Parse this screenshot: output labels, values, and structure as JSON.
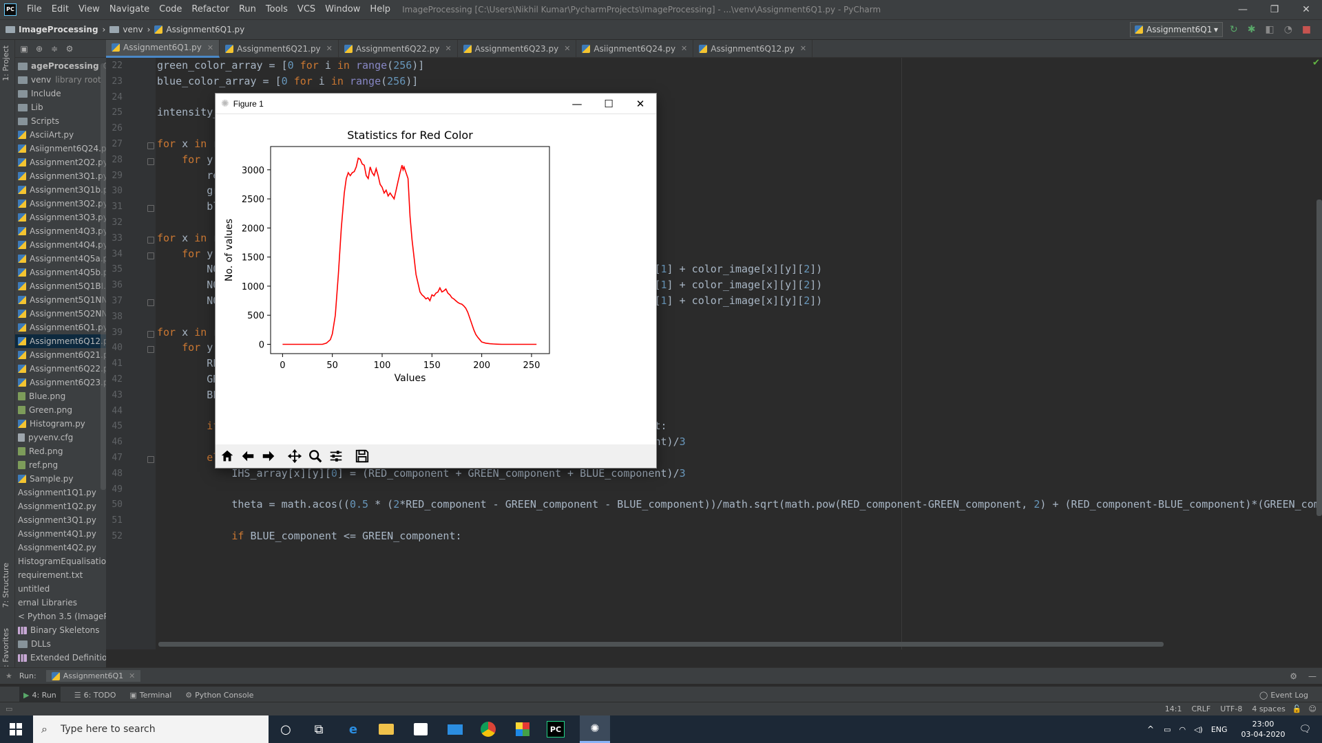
{
  "titlebar": {
    "menu": [
      "File",
      "Edit",
      "View",
      "Navigate",
      "Code",
      "Refactor",
      "Run",
      "Tools",
      "VCS",
      "Window",
      "Help"
    ],
    "window_title": "ImageProcessing [C:\\Users\\Nikhil Kumar\\PycharmProjects\\ImageProcessing] - ...\\venv\\Assignment6Q1.py - PyCharm",
    "app_icon_text": "PC"
  },
  "breadcrumb": {
    "project": "ImageProcessing",
    "folder": "venv",
    "file": "Assignment6Q1.py"
  },
  "run_config": {
    "label": "Assignment6Q1"
  },
  "side_tabs": {
    "project": "1: Project",
    "structure": "7: Structure",
    "favorites": "2: Favorites"
  },
  "project_tree": [
    {
      "label": "ageProcessing",
      "extra": "C:\\Users\\",
      "type": "folder",
      "bold": true
    },
    {
      "label": "venv",
      "extra": "library root",
      "type": "folder"
    },
    {
      "label": "Include",
      "type": "folder"
    },
    {
      "label": "Lib",
      "type": "folder"
    },
    {
      "label": "Scripts",
      "type": "folder"
    },
    {
      "label": "AsciiArt.py",
      "type": "py"
    },
    {
      "label": "Asiignment6Q24.py",
      "type": "py"
    },
    {
      "label": "Assignment2Q2.py",
      "type": "py"
    },
    {
      "label": "Assignment3Q1.py",
      "type": "py"
    },
    {
      "label": "Assignment3Q1b.py",
      "type": "py"
    },
    {
      "label": "Assignment3Q2.py",
      "type": "py"
    },
    {
      "label": "Assignment3Q3.py",
      "type": "py"
    },
    {
      "label": "Assignment4Q3.py",
      "type": "py"
    },
    {
      "label": "Assignment4Q4.py",
      "type": "py"
    },
    {
      "label": "Assignment4Q5a.py",
      "type": "py"
    },
    {
      "label": "Assignment4Q5b.py",
      "type": "py"
    },
    {
      "label": "Assignment5Q1BI.py",
      "type": "py"
    },
    {
      "label": "Assignment5Q1NN.p",
      "type": "py"
    },
    {
      "label": "Assignment5Q2NND",
      "type": "py"
    },
    {
      "label": "Assignment6Q1.py",
      "type": "py"
    },
    {
      "label": "Assignment6Q12.py",
      "type": "py",
      "selected": true
    },
    {
      "label": "Assignment6Q21.py",
      "type": "py"
    },
    {
      "label": "Assignment6Q22.py",
      "type": "py"
    },
    {
      "label": "Assignment6Q23.py",
      "type": "py"
    },
    {
      "label": "Blue.png",
      "type": "img"
    },
    {
      "label": "Green.png",
      "type": "img"
    },
    {
      "label": "Histogram.py",
      "type": "py"
    },
    {
      "label": "pyvenv.cfg",
      "type": "txt"
    },
    {
      "label": "Red.png",
      "type": "img"
    },
    {
      "label": "ref.png",
      "type": "img"
    },
    {
      "label": "Sample.py",
      "type": "py"
    },
    {
      "label": "Assignment1Q1.py",
      "type": "plain"
    },
    {
      "label": "Assignment1Q2.py",
      "type": "plain"
    },
    {
      "label": "Assignment3Q1.py",
      "type": "plain"
    },
    {
      "label": "Assignment4Q1.py",
      "type": "plain"
    },
    {
      "label": "Assignment4Q2.py",
      "type": "plain"
    },
    {
      "label": "HistogramEqualisation.p",
      "type": "plain"
    },
    {
      "label": "requirement.txt",
      "type": "plain"
    },
    {
      "label": "untitled",
      "type": "plain"
    },
    {
      "label": "ernal Libraries",
      "type": "plain"
    },
    {
      "label": "< Python 3.5 (ImageProc",
      "type": "plain"
    },
    {
      "label": "Binary Skeletons",
      "type": "lib"
    },
    {
      "label": "DLLs",
      "type": "folder"
    },
    {
      "label": "Extended Definitions",
      "type": "lib"
    }
  ],
  "editor_tabs": [
    {
      "label": "Assignment6Q1.py",
      "active": true
    },
    {
      "label": "Assignment6Q21.py"
    },
    {
      "label": "Assignment6Q22.py"
    },
    {
      "label": "Assignment6Q23.py"
    },
    {
      "label": "Asiignment6Q24.py"
    },
    {
      "label": "Assignment6Q12.py"
    }
  ],
  "code_lines": [
    {
      "n": "22",
      "html": "green_color_array = [<span class='num'>0</span> <span class='kw'>for</span> i <span class='kw'>in</span> <span class='bi'>range</span>(<span class='num'>256</span>)]"
    },
    {
      "n": "23",
      "html": "blue_color_array = [<span class='num'>0</span> <span class='kw'>for</span> i <span class='kw'>in</span> <span class='bi'>range</span>(<span class='num'>256</span>)]"
    },
    {
      "n": "24",
      "html": ""
    },
    {
      "n": "25",
      "html": "intensity_"
    },
    {
      "n": "26",
      "html": ""
    },
    {
      "n": "27",
      "html": "<span class='kw'>for</span> x <span class='kw'>in</span> r"
    },
    {
      "n": "28",
      "html": "    <span class='kw'>for</span> y"
    },
    {
      "n": "29",
      "html": "        re"
    },
    {
      "n": "30",
      "html": "        gr"
    },
    {
      "n": "31",
      "html": "        bl"
    },
    {
      "n": "32",
      "html": ""
    },
    {
      "n": "33",
      "html": "<span class='kw'>for</span> x <span class='kw'>in</span> r"
    },
    {
      "n": "34",
      "html": "    <span class='kw'>for</span> y"
    },
    {
      "n": "35",
      "html": "        NO                                               [<span class='num'>0</span>] + color_image[x][y][<span class='num'>1</span>] + color_image[x][y][<span class='num'>2</span>])"
    },
    {
      "n": "36",
      "html": "        NO                                               [<span class='num'>0</span>] + color_image[x][y][<span class='num'>1</span>] + color_image[x][y][<span class='num'>2</span>])"
    },
    {
      "n": "37",
      "html": "        NO                                               [<span class='num'>0</span>] + color_image[x][y][<span class='num'>1</span>] + color_image[x][y][<span class='num'>2</span>])"
    },
    {
      "n": "38",
      "html": ""
    },
    {
      "n": "39",
      "html": "<span class='kw'>for</span> x <span class='kw'>in</span> r"
    },
    {
      "n": "40",
      "html": "    <span class='kw'>for</span> y"
    },
    {
      "n": "41",
      "html": "        RE"
    },
    {
      "n": "42",
      "html": "        GR"
    },
    {
      "n": "43",
      "html": "        BLUE_component = NORMALIZED_image_array[x][y][<span class='num'>2</span>]"
    },
    {
      "n": "44",
      "html": ""
    },
    {
      "n": "45",
      "html": "        <span class='kw'>if</span> RED_component == GREEN_component <span class='kw'>and</span> GREEN_component == BLUE_component:"
    },
    {
      "n": "46",
      "html": "            IHS_array[x][y][<span class='num'>0</span>] = (RED_component + GREEN_component + BLUE_component)/<span class='num'>3</span>"
    },
    {
      "n": "47",
      "html": "        <span class='kw'>else</span>:"
    },
    {
      "n": "48",
      "html": "            IHS_array[x][y][<span class='num'>0</span>] = (RED_component + GREEN_component + BLUE_component)/<span class='num'>3</span>"
    },
    {
      "n": "49",
      "html": ""
    },
    {
      "n": "50",
      "html": "            theta = math.acos((<span class='num'>0.5</span> * (<span class='num'>2</span>*RED_component - GREEN_component - BLUE_component))/math.sqrt(math.pow(RED_component-GREEN_component, <span class='num'>2</span>) + (RED_component-BLUE_component)*(GREEN_comp"
    },
    {
      "n": "51",
      "html": ""
    },
    {
      "n": "52",
      "html": "            <span class='kw'>if</span> BLUE_component &lt;= GREEN_component:"
    }
  ],
  "figure": {
    "window_title": "Figure 1"
  },
  "chart_data": {
    "type": "line",
    "title": "Statistics for Red Color",
    "xlabel": "Values",
    "ylabel": "No. of values",
    "xlim": [
      -12,
      268
    ],
    "ylim": [
      -160,
      3400
    ],
    "xticks": [
      0,
      50,
      100,
      150,
      200,
      250
    ],
    "yticks": [
      0,
      500,
      1000,
      1500,
      2000,
      2500,
      3000
    ],
    "grid": false,
    "series": [
      {
        "color": "#ff0000",
        "x": [
          0,
          20,
          40,
          44,
          48,
          50,
          53,
          56,
          59,
          62,
          64,
          66,
          68,
          70,
          72,
          74,
          76,
          78,
          80,
          82,
          84,
          86,
          88,
          90,
          92,
          94,
          96,
          98,
          100,
          102,
          104,
          106,
          108,
          110,
          112,
          114,
          116,
          118,
          120,
          121,
          122,
          124,
          126,
          128,
          130,
          132,
          134,
          136,
          138,
          140,
          142,
          144,
          146,
          148,
          150,
          152,
          154,
          156,
          158,
          160,
          162,
          164,
          166,
          168,
          170,
          172,
          174,
          176,
          178,
          180,
          182,
          184,
          186,
          188,
          190,
          192,
          194,
          196,
          198,
          200,
          204,
          208,
          212,
          216,
          220,
          230,
          240,
          255
        ],
        "y": [
          0,
          0,
          0,
          20,
          80,
          180,
          500,
          1200,
          2000,
          2600,
          2850,
          2950,
          2900,
          2950,
          2970,
          3050,
          3200,
          3180,
          3100,
          3080,
          2900,
          2850,
          3050,
          2950,
          2900,
          3020,
          2900,
          2750,
          2700,
          2600,
          2650,
          2550,
          2600,
          2550,
          2500,
          2650,
          2800,
          2950,
          3080,
          3000,
          3050,
          2950,
          2850,
          2200,
          1800,
          1500,
          1200,
          1050,
          900,
          850,
          820,
          780,
          800,
          750,
          850,
          830,
          880,
          900,
          970,
          900,
          920,
          950,
          880,
          850,
          800,
          780,
          750,
          720,
          700,
          690,
          660,
          620,
          550,
          450,
          350,
          250,
          170,
          120,
          80,
          40,
          20,
          10,
          5,
          2,
          0,
          0,
          0,
          0
        ]
      }
    ]
  },
  "run_bar": {
    "label": "Run:",
    "config": "Assignment6Q1"
  },
  "bottom_tabs": [
    "4: Run",
    "6: TODO",
    "Terminal",
    "Python Console"
  ],
  "event_log": "Event Log",
  "status": {
    "position": "14:1",
    "line_sep": "CRLF",
    "encoding": "UTF-8",
    "indent": "4 spaces"
  },
  "taskbar": {
    "search_placeholder": "Type here to search",
    "lang": "ENG",
    "time": "23:00",
    "date": "03-04-2020"
  }
}
